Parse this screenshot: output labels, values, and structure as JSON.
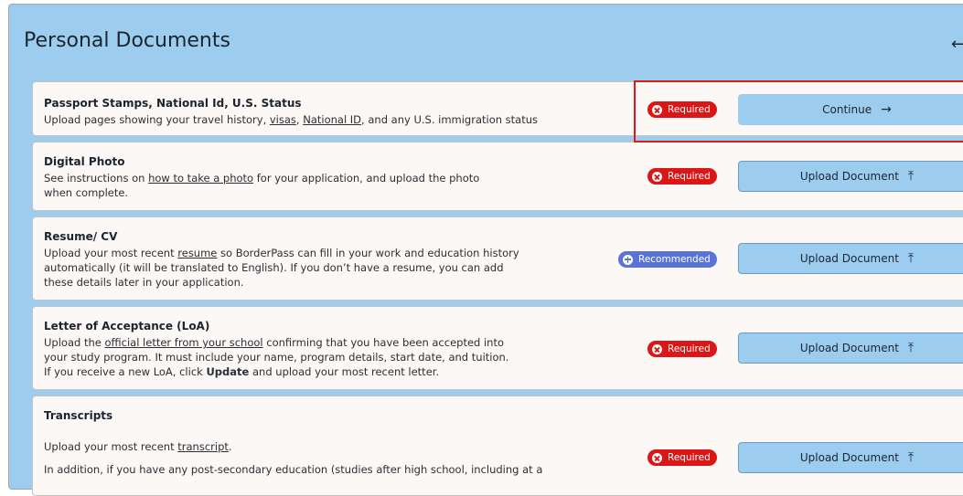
{
  "header": {
    "title": "Personal Documents",
    "corner_icon": "arrow-icon"
  },
  "colors": {
    "panel_bg": "#9ccdee",
    "card_bg": "#fcf8f5",
    "required": "#db1616",
    "recommended": "#5a73d6",
    "highlight": "#e01818"
  },
  "documents": [
    {
      "title": "Passport Stamps, National Id, U.S. Status",
      "desc_pre": "Upload pages showing your travel history, ",
      "link1": "visas",
      "desc_mid": ", ",
      "link2": "National ID",
      "desc_post": ", and any U.S. immigration status",
      "badge": "Required",
      "action": "Continue",
      "action_icon": "→"
    },
    {
      "title": "Digital Photo",
      "desc_pre": "See instructions on ",
      "link1": "how to take a photo",
      "desc_post": " for your application, and upload the photo when complete.",
      "badge": "Required",
      "action": "Upload Document",
      "action_icon": "⤒"
    },
    {
      "title": "Resume/ CV",
      "desc_pre": "Upload your most recent ",
      "link1": "resume",
      "desc_post": " so BorderPass can fill in your work and education history automatically (it will be translated to English). If you don’t have a resume, you can add these details later in your application.",
      "badge": "Recommended",
      "action": "Upload Document",
      "action_icon": "⤒"
    },
    {
      "title": "Letter of Acceptance (LoA)",
      "desc_pre": "Upload the ",
      "link1": "official letter from your school",
      "desc_post": " confirming that you have been accepted into your study program. It must include your name, program details, start date, and tuition.",
      "line2_pre": "If you receive a new LoA, click ",
      "line2_bold": "Update",
      "line2_post": " and upload your most recent letter.",
      "badge": "Required",
      "action": "Upload Document",
      "action_icon": "⤒"
    },
    {
      "title": "Transcripts",
      "desc_pre": "Upload your most recent ",
      "link1": "transcript",
      "desc_post": ".",
      "line2": "In addition, if you have any post-secondary education (studies after high school, including at a",
      "badge": "Required",
      "action": "Upload Document",
      "action_icon": "⤒"
    }
  ]
}
